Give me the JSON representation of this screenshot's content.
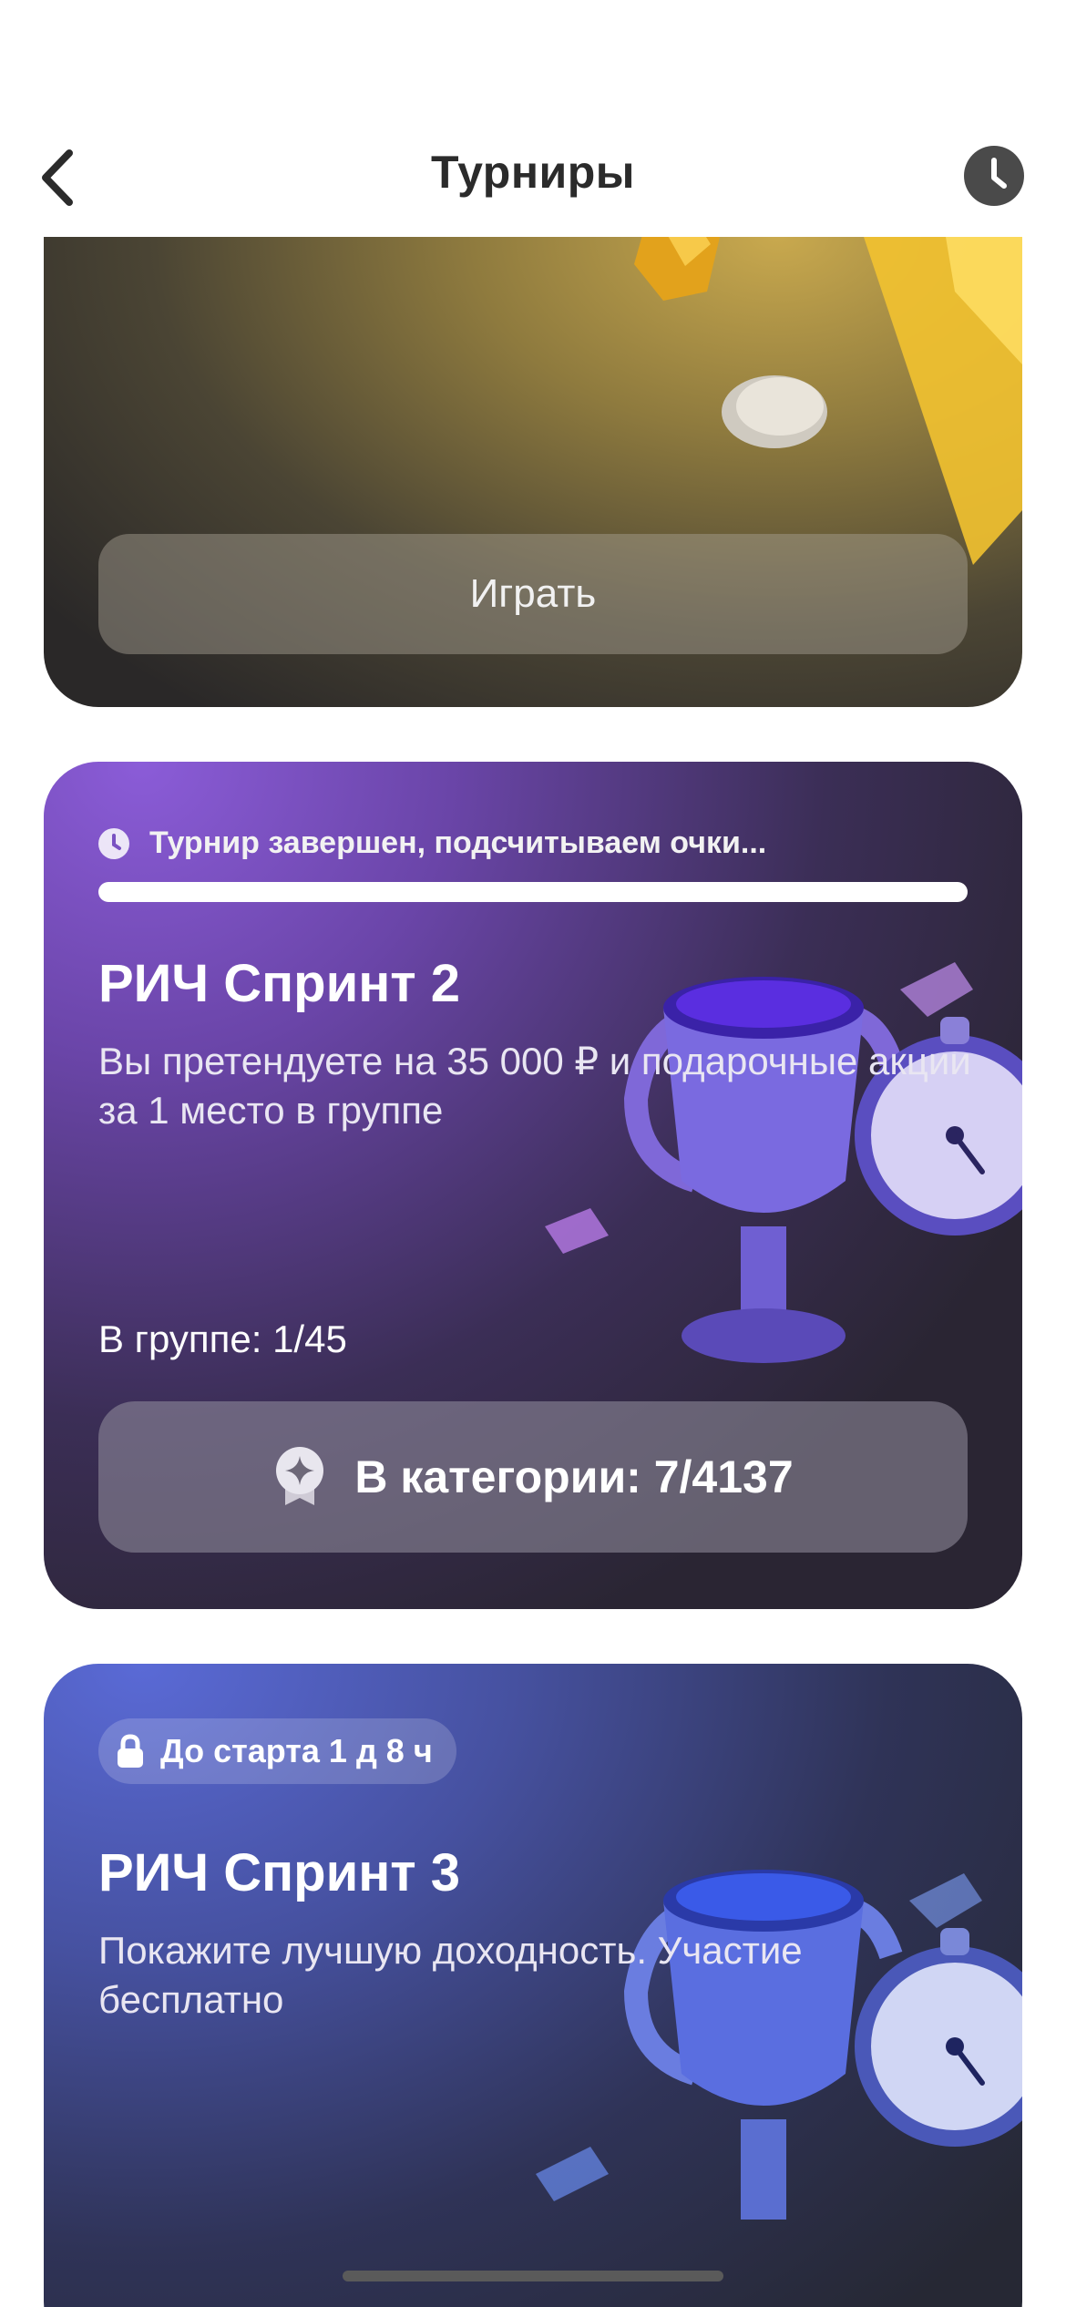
{
  "header": {
    "title": "Турниры",
    "back_icon": "chevron-left-icon",
    "history_icon": "clock-icon"
  },
  "cards": [
    {
      "play_label": "Играть"
    },
    {
      "status": "Турнир завершен, подсчитываем очки...",
      "progress": 1.0,
      "title": "РИЧ Спринт 2",
      "description": "Вы претендуете на 35 000 ₽ и подарочные акции за 1 место в группе",
      "group": "В группе: 1/45",
      "category": "В категории: 7/4137"
    },
    {
      "lock": "До старта 1 д 8 ч",
      "title": "РИЧ Спринт 3",
      "description": "Покажите лучшую доходность. Участие бесплатно"
    }
  ],
  "colors": {
    "card1_accent": "#c9a94e",
    "card2_accent": "#8b5cd8",
    "card3_accent": "#5a6ad6"
  }
}
